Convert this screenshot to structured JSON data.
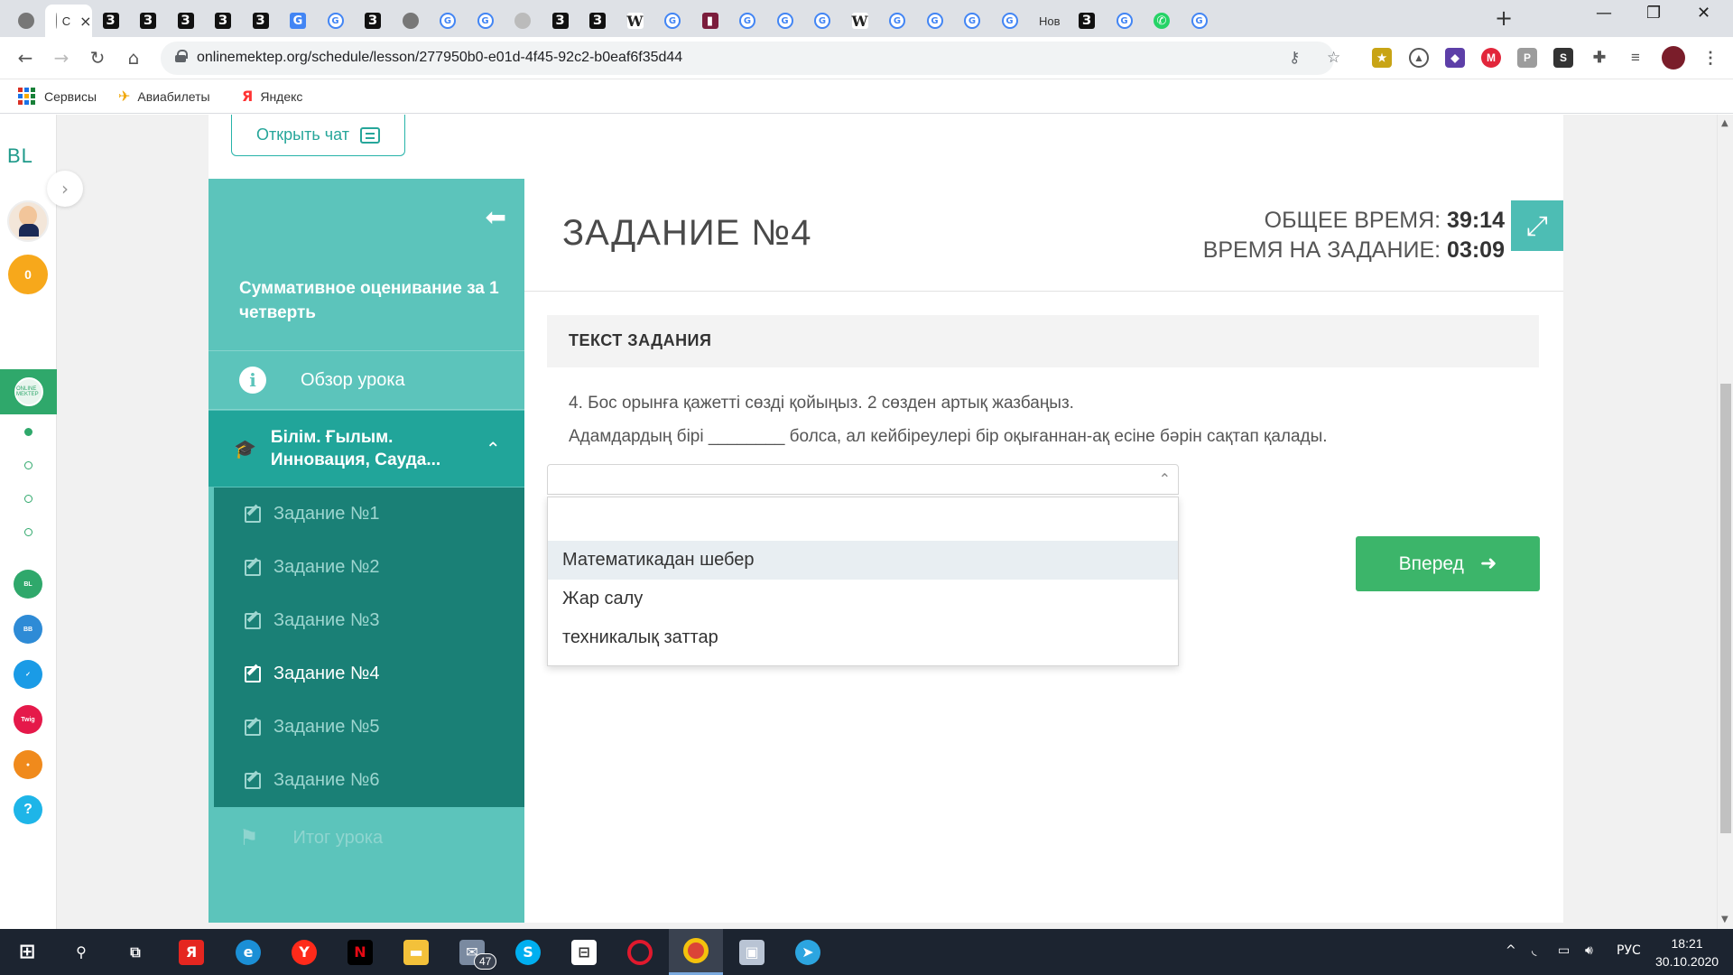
{
  "browser": {
    "tabs": [
      {
        "favicon": "globe-icon",
        "text": ""
      },
      {
        "favicon": "globe-icon",
        "text": "С",
        "active": true
      },
      {
        "favicon": "znanija-icon",
        "text": ""
      },
      {
        "favicon": "znanija-icon",
        "text": ""
      },
      {
        "favicon": "znanija-icon",
        "text": ""
      },
      {
        "favicon": "znanija-icon",
        "text": ""
      },
      {
        "favicon": "znanija-icon",
        "text": ""
      },
      {
        "favicon": "translate-icon",
        "text": ""
      },
      {
        "favicon": "google-icon",
        "text": ""
      },
      {
        "favicon": "znanija-icon",
        "text": ""
      },
      {
        "favicon": "globe-icon",
        "text": ""
      },
      {
        "favicon": "google-icon",
        "text": ""
      },
      {
        "favicon": "google-icon",
        "text": ""
      },
      {
        "favicon": "cat-icon",
        "text": ""
      },
      {
        "favicon": "znanija-icon",
        "text": ""
      },
      {
        "favicon": "znanija-icon",
        "text": ""
      },
      {
        "favicon": "wikipedia-icon",
        "text": ""
      },
      {
        "favicon": "google-icon",
        "text": ""
      },
      {
        "favicon": "video-icon",
        "text": ""
      },
      {
        "favicon": "google-icon",
        "text": ""
      },
      {
        "favicon": "google-icon",
        "text": ""
      },
      {
        "favicon": "google-icon",
        "text": ""
      },
      {
        "favicon": "wikipedia-icon",
        "text": ""
      },
      {
        "favicon": "google-icon",
        "text": ""
      },
      {
        "favicon": "google-icon",
        "text": ""
      },
      {
        "favicon": "google-icon",
        "text": ""
      },
      {
        "favicon": "google-icon",
        "text": ""
      },
      {
        "favicon": "none",
        "text": "Нов"
      },
      {
        "favicon": "znanija-icon",
        "text": ""
      },
      {
        "favicon": "google-icon",
        "text": ""
      },
      {
        "favicon": "whatsapp-icon",
        "text": ""
      },
      {
        "favicon": "google-icon",
        "text": ""
      }
    ],
    "url": "onlinemektep.org/schedule/lesson/277950b0-e01d-4f45-92c2-b0eaf6f35d44",
    "bookmarks": [
      {
        "icon": "apps-grid-icon",
        "label": "Сервисы"
      },
      {
        "icon": "plane-icon",
        "label": "Авиабилеты"
      },
      {
        "icon": "yandex-icon",
        "label": "Яндекс"
      }
    ]
  },
  "rail": {
    "logo": "BL",
    "coins": "0"
  },
  "lesson": {
    "open_chat": "Открыть чат",
    "side_title": "Суммативное оценивание за 1 четверть",
    "overview": "Обзор урока",
    "section": "Білім. Ғылым. Инновация, Сауда...",
    "tasks": [
      "Задание №1",
      "Задание №2",
      "Задание №3",
      "Задание №4",
      "Задание №5",
      "Задание №6"
    ],
    "current_task_index": 3,
    "final": "Итог урока"
  },
  "task": {
    "title": "ЗАДАНИЕ №4",
    "total_time_label": "ОБЩЕЕ ВРЕМЯ:",
    "total_time": "39:14",
    "task_time_label": "ВРЕМЯ НА ЗАДАНИЕ:",
    "task_time": "03:09",
    "text_header": "ТЕКСТ ЗАДАНИЯ",
    "question_line1": "4. Бос орынға қажетті сөзді қойыңыз. 2 сөзден артық жазбаңыз.",
    "question_line2": "Адамдардың бірі ________ болса, ал кейбіреулері бір оқығаннан-ақ есіне бәрін сақтап қалады.",
    "select_value": "",
    "options": [
      "Математикадан шебер",
      "Жар салу",
      "техникалық заттар"
    ],
    "hovered_option_index": 0,
    "next_label": "Вперед"
  },
  "taskbar": {
    "mail_badge": "47",
    "lang": "РУС",
    "time": "18:21",
    "date": "30.10.2020"
  },
  "colors": {
    "teal": "#5cc4bb",
    "teal_dark": "#1a8076",
    "teal_section": "#21a59a",
    "green_button": "#3cb56a"
  }
}
